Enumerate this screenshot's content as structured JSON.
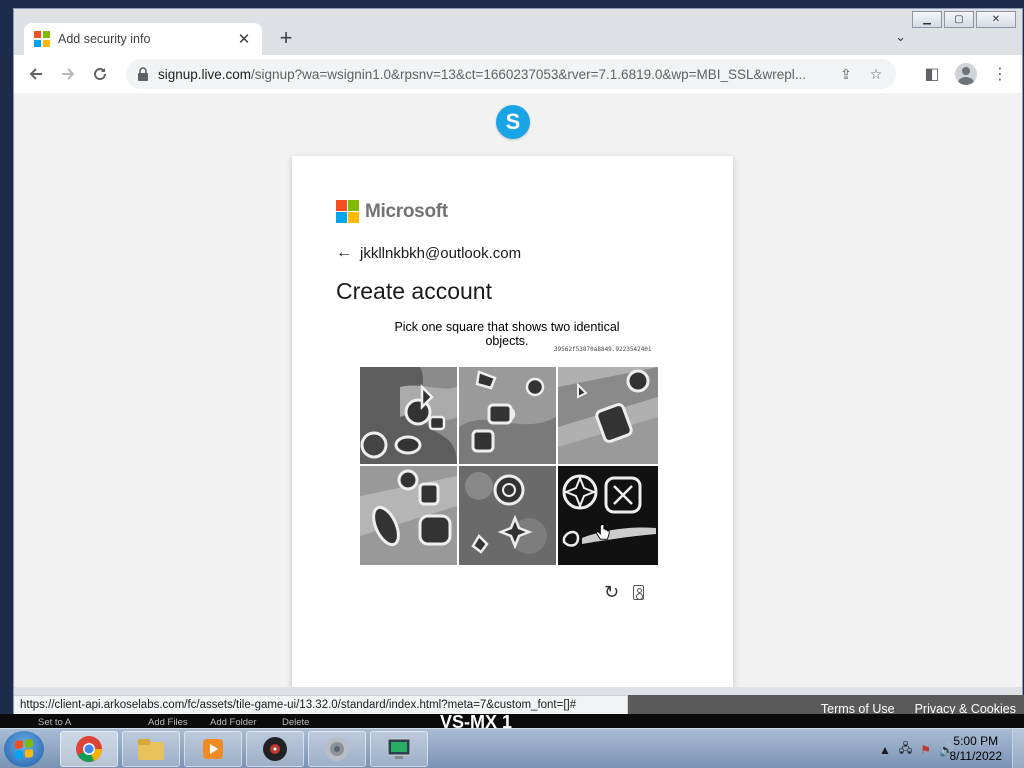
{
  "browser": {
    "tab_title": "Add security info",
    "tab_close": "✕",
    "new_tab": "+",
    "url_host": "signup.live.com",
    "url_path": "/signup?wa=wsignin1.0&rpsnv=13&ct=1660237053&rver=7.1.6819.0&wp=MBI_SSL&wrepl...",
    "status_url": "https://client-api.arkoselabs.com/fc/assets/tile-game-ui/13.32.0/standard/index.html?meta=7&custom_font=[]#"
  },
  "page": {
    "brand": "Microsoft",
    "identity_email": "jkkllnkbkh@outlook.com",
    "heading": "Create account",
    "captcha": {
      "instruction": "Pick one square that shows two identical objects.",
      "session_id": "39562f53870a8849.9223542401",
      "tiles": [
        {
          "id": 1,
          "selected": false
        },
        {
          "id": 2,
          "selected": false
        },
        {
          "id": 3,
          "selected": false
        },
        {
          "id": 4,
          "selected": false
        },
        {
          "id": 5,
          "selected": false
        },
        {
          "id": 6,
          "selected": true
        }
      ]
    },
    "footer": {
      "terms": "Terms of Use",
      "privacy": "Privacy & Cookies"
    }
  },
  "behind_window": {
    "label_1": "Set to A",
    "label_2": "Add Files",
    "label_3": "Add Folder",
    "label_4": "Delete",
    "big_text": "VS-MX 1"
  },
  "taskbar": {
    "time": "5:00 PM",
    "date": "8/11/2022"
  },
  "colors": {
    "ms_red": "#f25022",
    "ms_green": "#7fba00",
    "ms_blue": "#00a4ef",
    "ms_yellow": "#ffb900",
    "skype_blue": "#1aa4e8"
  }
}
